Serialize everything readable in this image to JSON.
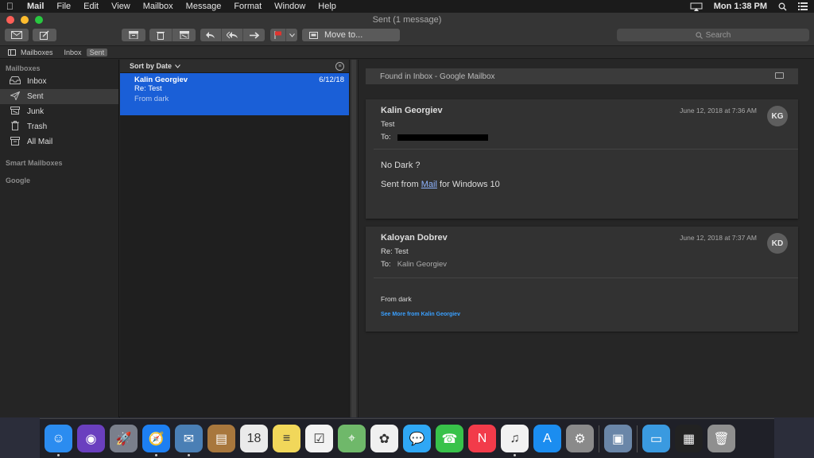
{
  "menubar": {
    "app_name": "Mail",
    "items": [
      "File",
      "Edit",
      "View",
      "Mailbox",
      "Message",
      "Format",
      "Window",
      "Help"
    ],
    "clock": "Mon 1:38 PM"
  },
  "window": {
    "title": "Sent (1 message)",
    "toolbar": {
      "move_to": "Move to...",
      "search_placeholder": "Search"
    }
  },
  "favorites": {
    "mailboxes": "Mailboxes",
    "inbox": "Inbox",
    "sent": "Sent"
  },
  "sidebar": {
    "heading": "Mailboxes",
    "items": [
      {
        "label": "Inbox",
        "icon": "inbox-icon"
      },
      {
        "label": "Sent",
        "icon": "sent-icon"
      },
      {
        "label": "Junk",
        "icon": "junk-icon"
      },
      {
        "label": "Trash",
        "icon": "trash-icon"
      },
      {
        "label": "All Mail",
        "icon": "archive-icon"
      }
    ],
    "smart_mailboxes": "Smart Mailboxes",
    "google": "Google"
  },
  "message_list": {
    "sort_label": "Sort by Date",
    "messages": [
      {
        "from": "Kalin Georgiev",
        "subject": "Re: Test",
        "preview": "From dark",
        "date": "6/12/18"
      }
    ]
  },
  "reader": {
    "found_in": "Found in Inbox - Google Mailbox",
    "messages": [
      {
        "sender": "Kalin Georgiev",
        "subject": "Test",
        "to_label": "To:",
        "date": "June 12, 2018 at 7:36 AM",
        "initials": "KG",
        "line1": "No Dark ?",
        "line2_prefix": "Sent from ",
        "line2_link": "Mail",
        "line2_suffix": " for Windows 10"
      },
      {
        "sender": "Kaloyan Dobrev",
        "subject": "Re: Test",
        "to_label": "To:",
        "to": "Kalin Georgiev",
        "date": "June 12, 2018 at 7:37 AM",
        "initials": "KD",
        "body": "From dark",
        "see_more": "See More from Kalin Georgiev"
      }
    ]
  },
  "dock": {
    "apps": [
      {
        "name": "finder",
        "glyph": "☺",
        "color": "#2b8cf0",
        "running": true
      },
      {
        "name": "siri",
        "glyph": "◉",
        "color": "#6a3fbf",
        "running": false
      },
      {
        "name": "launchpad",
        "glyph": "🚀",
        "color": "#7a7f8c",
        "running": false
      },
      {
        "name": "safari",
        "glyph": "🧭",
        "color": "#1d7ff2",
        "running": true
      },
      {
        "name": "mail-stamp",
        "glyph": "✉",
        "color": "#4a7fb5",
        "running": true
      },
      {
        "name": "contacts",
        "glyph": "▤",
        "color": "#a8773d",
        "running": false
      },
      {
        "name": "calendar",
        "glyph": "18",
        "color": "#eaeaea",
        "running": false
      },
      {
        "name": "notes",
        "glyph": "≡",
        "color": "#f1d75a",
        "running": false
      },
      {
        "name": "reminders",
        "glyph": "☑",
        "color": "#f2f2f2",
        "running": false
      },
      {
        "name": "maps",
        "glyph": "⌖",
        "color": "#6fb86a",
        "running": false
      },
      {
        "name": "photos",
        "glyph": "✿",
        "color": "#f0f0f0",
        "running": false
      },
      {
        "name": "messages",
        "glyph": "💬",
        "color": "#2fa7f5",
        "running": false
      },
      {
        "name": "facetime",
        "glyph": "☎",
        "color": "#38c24a",
        "running": false
      },
      {
        "name": "news",
        "glyph": "N",
        "color": "#f23b4a",
        "running": false
      },
      {
        "name": "itunes",
        "glyph": "♫",
        "color": "#f2f2f2",
        "running": true
      },
      {
        "name": "app-store",
        "glyph": "A",
        "color": "#1b8df0",
        "running": false
      },
      {
        "name": "system-preferences",
        "glyph": "⚙",
        "color": "#8a8a8a",
        "running": false
      },
      {
        "name": "preview",
        "glyph": "▣",
        "color": "#6a86a8",
        "running": false
      },
      {
        "name": "downloads-folder",
        "glyph": "▭",
        "color": "#3a9ae0",
        "running": false
      },
      {
        "name": "screen-thumbnail",
        "glyph": "▦",
        "color": "#222222",
        "running": false
      },
      {
        "name": "trash",
        "glyph": "🗑",
        "color": "#8f8f8f",
        "running": false
      }
    ]
  }
}
